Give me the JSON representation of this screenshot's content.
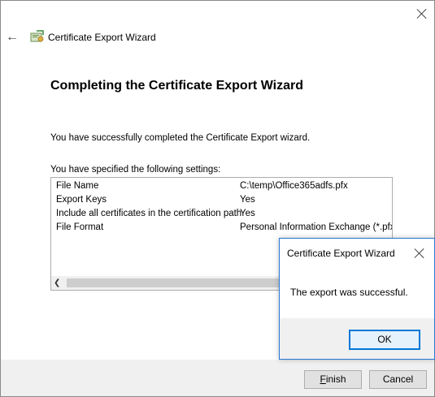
{
  "wizard": {
    "window_title": "Certificate Export Wizard",
    "heading": "Completing the Certificate Export Wizard",
    "success_text": "You have successfully completed the Certificate Export wizard.",
    "settings_intro": "You have specified the following settings:",
    "settings": [
      {
        "key": "File Name",
        "value": "C:\\temp\\Office365adfs.pfx"
      },
      {
        "key": "Export Keys",
        "value": "Yes"
      },
      {
        "key": "Include all certificates in the certification path",
        "value": "Yes"
      },
      {
        "key": "File Format",
        "value": "Personal Information Exchange (*.pfx)"
      }
    ],
    "finish_mnemonic": "F",
    "finish_rest": "inish",
    "cancel_label": "Cancel",
    "icons": {
      "back": "back-arrow-icon",
      "close": "close-icon",
      "app": "certificate-icon",
      "scroll_left": "scroll-left-arrow-icon"
    }
  },
  "message_box": {
    "title": "Certificate Export Wizard",
    "message": "The export was successful.",
    "ok_label": "OK"
  },
  "colors": {
    "accent": "#0078d7",
    "footer_bg": "#f0f0f0"
  }
}
